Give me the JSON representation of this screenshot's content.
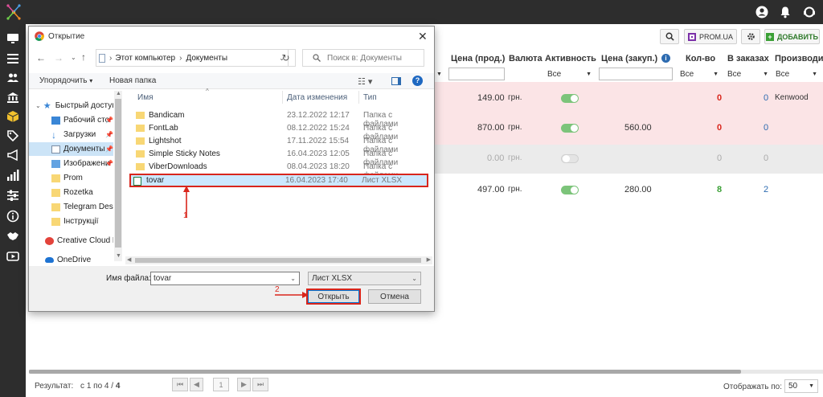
{
  "dialog": {
    "title": "Открытие",
    "breadcrumb": [
      "Этот компьютер",
      "Документы"
    ],
    "search_placeholder": "Поиск в: Документы",
    "commands": {
      "organize": "Упорядочить",
      "new_folder": "Новая папка"
    },
    "nav_items": [
      {
        "label": "Быстрый доступ",
        "icon": "star-icon",
        "pinned": false
      },
      {
        "label": "Рабочий сто",
        "icon": "desktop-folder-icon",
        "pinned": true
      },
      {
        "label": "Загрузки",
        "icon": "download-arrow-icon",
        "pinned": true
      },
      {
        "label": "Документы",
        "icon": "documents-icon",
        "pinned": true
      },
      {
        "label": "Изображени",
        "icon": "pictures-icon",
        "pinned": true
      },
      {
        "label": "Prom",
        "icon": "folder-icon",
        "pinned": false
      },
      {
        "label": "Rozetka",
        "icon": "folder-icon",
        "pinned": false
      },
      {
        "label": "Telegram Deskto",
        "icon": "folder-icon",
        "pinned": false
      },
      {
        "label": "Інструкції",
        "icon": "folder-icon",
        "pinned": false
      },
      {
        "label": "Creative Cloud Fil",
        "icon": "creative-cloud-icon",
        "pinned": false
      },
      {
        "label": "OneDrive",
        "icon": "onedrive-cloud-icon",
        "pinned": false
      }
    ],
    "columns": {
      "name": "Имя",
      "date": "Дата изменения",
      "type": "Тип"
    },
    "files": [
      {
        "name": "Bandicam",
        "date": "23.12.2022 12:17",
        "type": "Папка с файлами",
        "icon": "folder-icon"
      },
      {
        "name": "FontLab",
        "date": "08.12.2022 15:24",
        "type": "Папка с файлами",
        "icon": "folder-icon"
      },
      {
        "name": "Lightshot",
        "date": "17.11.2022 15:54",
        "type": "Папка с файлами",
        "icon": "folder-icon"
      },
      {
        "name": "Simple Sticky Notes",
        "date": "16.04.2023 12:05",
        "type": "Папка с файлами",
        "icon": "folder-icon"
      },
      {
        "name": "ViberDownloads",
        "date": "08.04.2023 18:20",
        "type": "Папка с файлами",
        "icon": "folder-icon"
      },
      {
        "name": "tovar",
        "date": "16.04.2023 17:40",
        "type": "Лист XLSX",
        "icon": "xlsx-file-icon"
      }
    ],
    "selected_file_index": 5,
    "filename_label": "Имя файла:",
    "filename_value": "tovar",
    "filetype_value": "Лист XLSX",
    "open_button": "Открыть",
    "cancel_button": "Отмена",
    "annotation_1": "1",
    "annotation_2": "2"
  },
  "toolbar": {
    "prom_label": "PROM.UA",
    "add_label": "ДОБАВИТЬ"
  },
  "table": {
    "headers": [
      "Цена (прод.)",
      "Валюта",
      "Активность",
      "Цена (закуп.)",
      "Кол-во",
      "В заказах",
      "Производи"
    ],
    "filter_all": "Все",
    "rows": [
      {
        "price": "149.00",
        "currency": "грн.",
        "active": true,
        "purchase": "",
        "qty": "0",
        "orders": "0",
        "maker": "Kenwood",
        "bg": "#fbe4e6"
      },
      {
        "price": "870.00",
        "currency": "грн.",
        "active": true,
        "purchase": "560.00",
        "qty": "0",
        "orders": "0",
        "maker": "",
        "bg": "#fbe4e6"
      },
      {
        "price": "0.00",
        "currency": "грн.",
        "active": false,
        "purchase": "",
        "qty": "0",
        "orders": "0",
        "maker": "",
        "bg": "#ebebeb"
      },
      {
        "price": "497.00",
        "currency": "грн.",
        "active": true,
        "purchase": "280.00",
        "qty": "8",
        "orders": "2",
        "maker": "",
        "bg": "#ffffff"
      }
    ]
  },
  "footer": {
    "result_label": "Результат:",
    "result_text": "с 1 по 4 /",
    "result_total": "4",
    "page_number": "1",
    "per_page_label": "Отображать по:",
    "per_page_value": "50"
  },
  "colors": {
    "accent_green": "#3aa035",
    "highlight_red": "#d9261c",
    "prom_purple": "#7b2fa8"
  }
}
